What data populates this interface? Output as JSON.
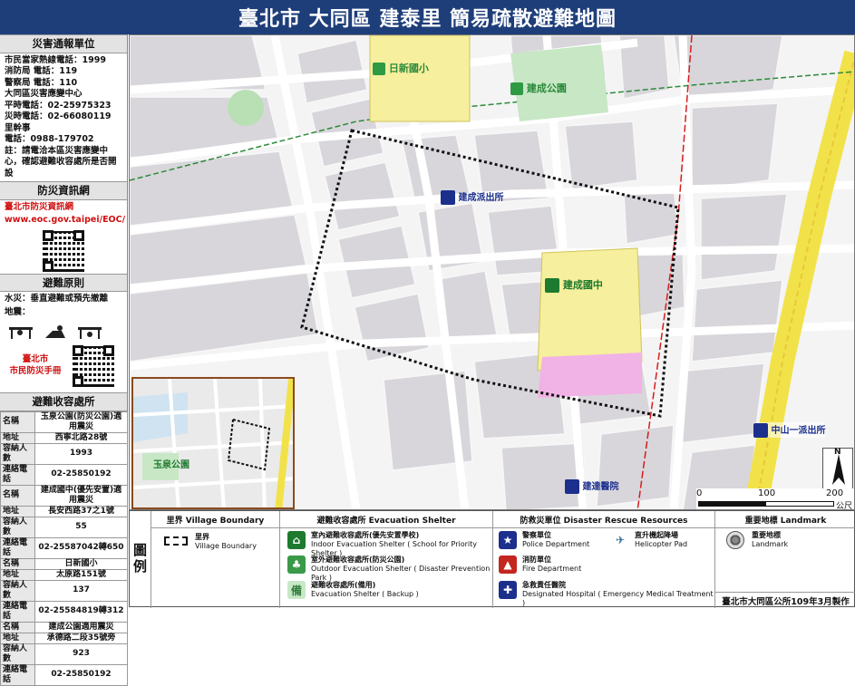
{
  "title": "臺北市 大同區 建泰里 簡易疏散避難地圖",
  "sidebar": {
    "report_head": "災害通報單位",
    "report_lines": [
      "市民當家熱線電話：1999",
      "消防局 電話：119",
      "警察局 電話：110",
      "大同區災害應變中心",
      "平時電話：02-25975323",
      "災時電話：02-66080119",
      "里幹事",
      "電話：0988-179702",
      "註：請電洽本區災害應變中心，確認避難收容處所是否開設"
    ],
    "web_head": "防災資訊網",
    "web_name": "臺北市防災資訊網",
    "web_url": "www.eoc.gov.taipei/EOC/",
    "principle_head": "避難原則",
    "principle_flood": "水災：垂直避難或預先撤離",
    "principle_quake": "地震：",
    "handbook": "臺北市\n市民防災手冊",
    "shelter_head": "避難收容處所",
    "shelters": [
      {
        "name": "玉泉公園(防災公園)適用震災",
        "addr": "西寧北路28號",
        "cap": "1993",
        "tel": "02-25850192"
      },
      {
        "name": "建成國中(優先安置)適用震災",
        "addr": "長安西路37之1號",
        "cap": "55",
        "tel": "02-25587042轉650"
      },
      {
        "name": "日新國小",
        "addr": "太原路151號",
        "cap": "137",
        "tel": "02-25584819轉312"
      },
      {
        "name": "建成公園適用震災",
        "addr": "承德路二段35號旁",
        "cap": "923",
        "tel": "02-25850192"
      }
    ],
    "row_labels": {
      "name": "名稱",
      "addr": "地址",
      "cap": "容納人數",
      "tel": "連絡電話"
    }
  },
  "map": {
    "labels": {
      "rixin": "日新國小",
      "jiancheng_park": "建成公園",
      "jiancheng_school": "建成國中",
      "police1": "建成派出所",
      "police2": "中山一派出所",
      "hospital": "建達醫院",
      "yuquan": "玉泉公園"
    },
    "scale": [
      "0",
      "100",
      "200",
      "公尺"
    ],
    "north": "N"
  },
  "legend": {
    "boundary_head": "里界 Village Boundary",
    "boundary_zh": "里界",
    "boundary_en": "Village Boundary",
    "shelter_head": "避難收容處所 Evacuation Shelter",
    "s1_zh": "室內避難收容處所(優先安置學校)",
    "s1_en": "Indoor Evacuation Shelter ( School for Priority Shelter )",
    "s2_zh": "室外避難收容處所(防災公園)",
    "s2_en": "Outdoor Evacuation Shelter ( Disaster Prevention Park )",
    "s3_zh": "避難收容處所(備用)",
    "s3_en": "Evacuation Shelter ( Backup )",
    "rescue_head": "防救災單位 Disaster Rescue Resources",
    "r1_zh": "警察單位",
    "r1_en": "Police Department",
    "r2_zh": "消防單位",
    "r2_en": "Fire Department",
    "r3_zh": "急救責任醫院",
    "r3_en": "Designated Hospital ( Emergency Medical Treatment )",
    "r4_zh": "直升機起降場",
    "r4_en": "Helicopter Pad",
    "landmark_head": "重要地標 Landmark",
    "l1_zh": "重要地標",
    "l1_en": "Landmark",
    "side": "圖\n例",
    "footer": "臺北市大同區公所109年3月製作"
  }
}
